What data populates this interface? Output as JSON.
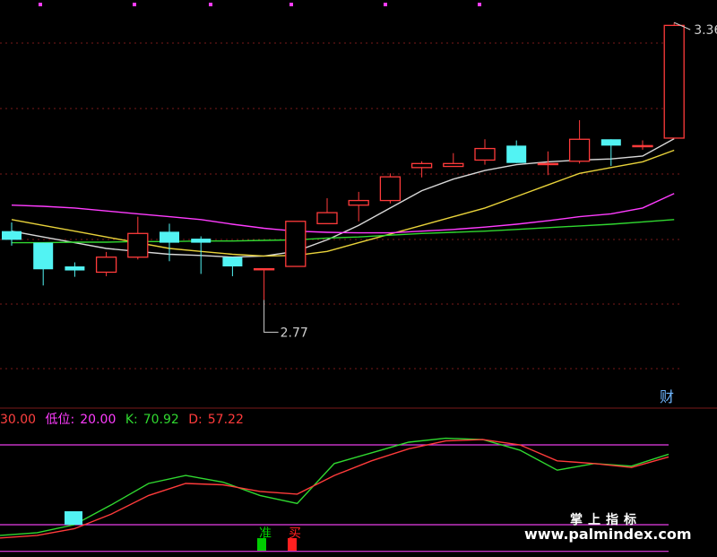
{
  "chart_data": [
    {
      "type": "candlestick",
      "price_labels": {
        "high": "3.36",
        "low": "2.77"
      },
      "candles": [
        {
          "o": 3.0,
          "h": 3.015,
          "l": 2.975,
          "c": 2.985
        },
        {
          "o": 2.98,
          "h": 2.98,
          "l": 2.906,
          "c": 2.934
        },
        {
          "o": 2.939,
          "h": 2.946,
          "l": 2.921,
          "c": 2.932
        },
        {
          "o": 2.929,
          "h": 2.964,
          "l": 2.922,
          "c": 2.955
        },
        {
          "o": 2.955,
          "h": 3.025,
          "l": 2.951,
          "c": 2.996
        },
        {
          "o": 2.999,
          "h": 3.013,
          "l": 2.948,
          "c": 2.98
        },
        {
          "o": 2.987,
          "h": 2.991,
          "l": 2.926,
          "c": 2.98
        },
        {
          "o": 2.955,
          "h": 2.955,
          "l": 2.922,
          "c": 2.939
        },
        {
          "o": 2.935,
          "h": 2.935,
          "l": 2.881,
          "c": 2.935
        },
        {
          "o": 2.939,
          "h": 3.017,
          "l": 2.939,
          "c": 3.017
        },
        {
          "o": 3.013,
          "h": 3.057,
          "l": 3.013,
          "c": 3.032
        },
        {
          "o": 3.045,
          "h": 3.068,
          "l": 3.017,
          "c": 3.053
        },
        {
          "o": 3.053,
          "h": 3.1,
          "l": 3.048,
          "c": 3.094
        },
        {
          "o": 3.11,
          "h": 3.121,
          "l": 3.093,
          "c": 3.117
        },
        {
          "o": 3.112,
          "h": 3.135,
          "l": 3.112,
          "c": 3.117
        },
        {
          "o": 3.123,
          "h": 3.159,
          "l": 3.115,
          "c": 3.143
        },
        {
          "o": 3.148,
          "h": 3.157,
          "l": 3.118,
          "c": 3.118
        },
        {
          "o": 3.117,
          "h": 3.138,
          "l": 3.097,
          "c": 3.117
        },
        {
          "o": 3.121,
          "h": 3.192,
          "l": 3.117,
          "c": 3.159
        },
        {
          "o": 3.159,
          "h": 3.159,
          "l": 3.113,
          "c": 3.148
        },
        {
          "o": 3.148,
          "h": 3.157,
          "l": 3.141,
          "c": 3.148
        },
        {
          "o": 3.161,
          "h": 3.361,
          "l": 3.161,
          "c": 3.356
        }
      ],
      "ma_lines": [
        {
          "color": "#d8d8d8",
          "values": [
            3.0,
            2.99,
            2.98,
            2.97,
            2.965,
            2.96,
            2.958,
            2.955,
            2.957,
            2.965,
            2.985,
            3.01,
            3.04,
            3.07,
            3.09,
            3.105,
            3.115,
            3.12,
            3.123,
            3.125,
            3.13,
            3.16
          ]
        },
        {
          "color": "#e8d23a",
          "values": [
            3.02,
            3.01,
            3.0,
            2.99,
            2.98,
            2.97,
            2.965,
            2.96,
            2.957,
            2.958,
            2.965,
            2.98,
            2.995,
            3.01,
            3.025,
            3.04,
            3.06,
            3.08,
            3.1,
            3.11,
            3.12,
            3.14
          ]
        },
        {
          "color": "#ff3cff",
          "values": [
            3.045,
            3.043,
            3.04,
            3.035,
            3.03,
            3.025,
            3.02,
            3.012,
            3.005,
            3.0,
            2.998,
            2.997,
            2.997,
            3.0,
            3.003,
            3.007,
            3.012,
            3.018,
            3.025,
            3.03,
            3.04,
            3.065
          ]
        },
        {
          "color": "#30d830",
          "values": [
            2.98,
            2.98,
            2.981,
            2.981,
            2.982,
            2.982,
            2.983,
            2.983,
            2.984,
            2.985,
            2.988,
            2.99,
            2.993,
            2.996,
            2.998,
            3.0,
            3.003,
            3.006,
            3.009,
            3.012,
            3.016,
            3.02
          ]
        }
      ]
    },
    {
      "type": "line",
      "labels": {
        "main": "30.00",
        "low_label": "低位:",
        "low_value": "20.00",
        "k_label": "K:",
        "k_value": "70.92",
        "d_label": "D:",
        "d_value": "57.22"
      },
      "reference_lines": [
        {
          "value": 80,
          "color": "#e83ce8"
        },
        {
          "value": 20,
          "color": "#e83ce8"
        },
        {
          "value": 0,
          "color": "#e83ce8"
        }
      ],
      "series": [
        {
          "name": "K",
          "color": "#30d830",
          "values": [
            12,
            14,
            20,
            35,
            51,
            57,
            52,
            42,
            36,
            66,
            74,
            82,
            85,
            84,
            76,
            61,
            66,
            64,
            73
          ]
        },
        {
          "name": "D",
          "color": "#ff3b3b",
          "values": [
            10,
            12,
            17,
            28,
            42,
            51,
            50,
            45,
            43,
            57,
            68,
            77,
            83,
            84,
            80,
            68,
            66,
            63,
            71
          ]
        }
      ],
      "signals": [
        {
          "text": "准",
          "color": "#00cc00"
        },
        {
          "text": "买",
          "color": "#ff2020"
        }
      ]
    }
  ],
  "ui": {
    "cai_label": "财"
  },
  "watermark": {
    "title": "掌上指标",
    "url": "www.palmindex.com"
  }
}
